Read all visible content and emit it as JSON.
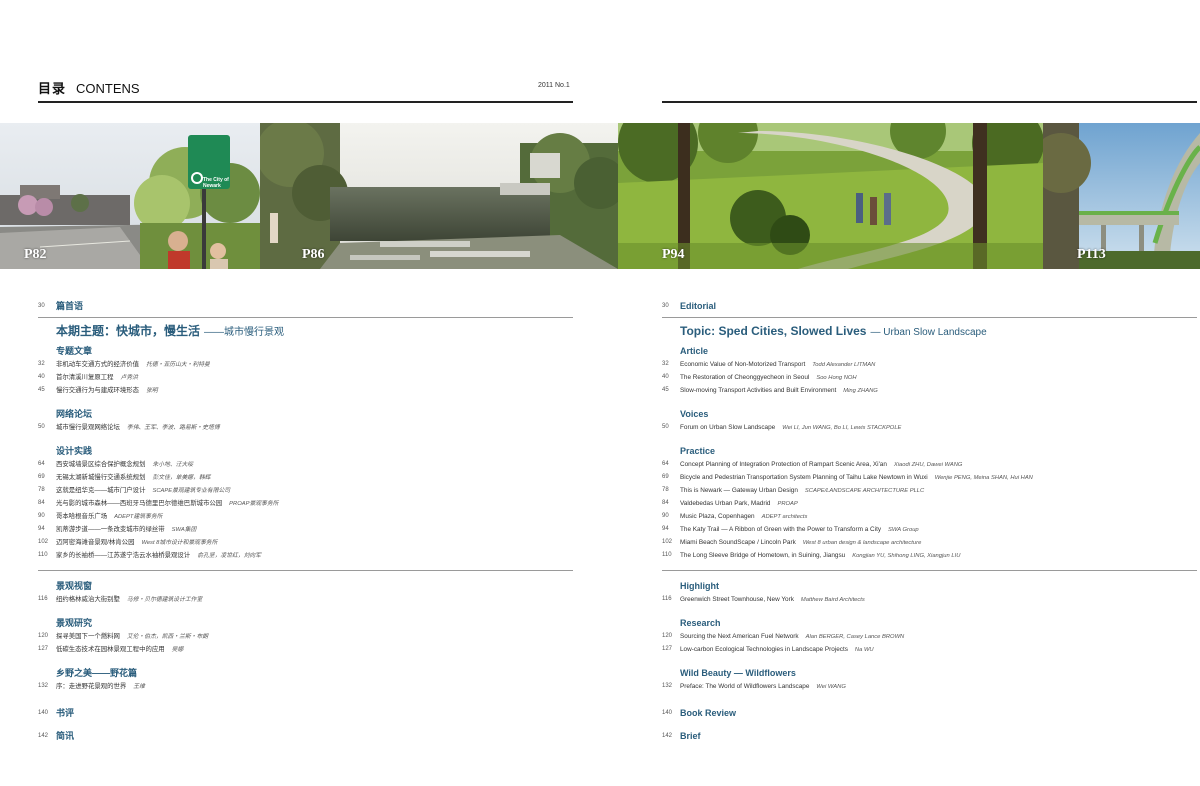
{
  "header": {
    "title_cn": "目录",
    "title_en": "CONTENS",
    "issue": "2011 No.1"
  },
  "photos": [
    {
      "label": "P82"
    },
    {
      "label": "P86"
    },
    {
      "label": "P94"
    },
    {
      "label": "P113"
    }
  ],
  "sign_text": {
    "line1": "The City of",
    "line2": "Newark"
  },
  "left": {
    "editorial": {
      "page": "30",
      "title": "篇首语"
    },
    "topic": {
      "title": "本期主题：快城市，慢生活",
      "sub": "——城市慢行景观"
    },
    "article": {
      "heading": "专题文章",
      "items": [
        {
          "page": "32",
          "title": "非机动车交通方式的经济价值",
          "author": "托德・亚历山大・利特曼"
        },
        {
          "page": "40",
          "title": "首尔清溪川复原工程",
          "author": "卢秀洪"
        },
        {
          "page": "45",
          "title": "慢行交通行为与建成环境形态",
          "author": "张明"
        }
      ]
    },
    "voices": {
      "heading": "网络论坛",
      "items": [
        {
          "page": "50",
          "title": "城市慢行景观网络论坛",
          "author": "李伟、王军、李波、路易斯・史塔博"
        }
      ]
    },
    "practice": {
      "heading": "设计实践",
      "items": [
        {
          "page": "64",
          "title": "西安城墙景区综合保护概念规划",
          "author": "朱小地、汪大绥"
        },
        {
          "page": "69",
          "title": "无锡太湖新城慢行交通系统规划",
          "author": "彭文佳，单美娜，韩辉"
        },
        {
          "page": "78",
          "title": "这就是纽华克——城市门户设计",
          "author": "SCAPE景观建筑专业有限公司"
        },
        {
          "page": "84",
          "title": "光与影的城市森林——西班牙马德里巴尔德维巴斯城市公园",
          "author": "PROAP景观事务所"
        },
        {
          "page": "90",
          "title": "哥本哈根音乐广场",
          "author": "ADEPT建筑事务所"
        },
        {
          "page": "94",
          "title": "凯蒂游步道——一条改变城市的绿丝带",
          "author": "SWA集团"
        },
        {
          "page": "102",
          "title": "迈阿密海滩音景观/林肯公园",
          "author": "West 8城市设计和景观事务所"
        },
        {
          "page": "110",
          "title": "家乡的长袖桥——江苏遂宁浩云水袖桥景观设计",
          "author": "俞孔坚，凌世红，刘向军"
        }
      ]
    },
    "highlight": {
      "heading": "景观视窗",
      "items": [
        {
          "page": "116",
          "title": "纽约格林威治大街别墅",
          "author": "马修・贝尔德建筑设计工作室"
        }
      ]
    },
    "research": {
      "heading": "景观研究",
      "items": [
        {
          "page": "120",
          "title": "探寻美国下一个燃料网",
          "author": "艾伦・伯杰，凯西・兰斯・布朗"
        },
        {
          "page": "127",
          "title": "低碳生态技术在园林景观工程中的应用",
          "author": "吴娜"
        }
      ]
    },
    "wild": {
      "heading": "乡野之美——野花篇",
      "items": [
        {
          "page": "132",
          "title": "序：走进野花景观的世界",
          "author": "王维"
        }
      ]
    },
    "book": {
      "page": "140",
      "title": "书评"
    },
    "brief": {
      "page": "142",
      "title": "简讯"
    }
  },
  "right": {
    "editorial": {
      "page": "30",
      "title": "Editorial"
    },
    "topic": {
      "title": "Topic: Sped Cities, Slowed Lives",
      "sub": "— Urban Slow Landscape"
    },
    "article": {
      "heading": "Article",
      "items": [
        {
          "page": "32",
          "title": "Economic Value of Non-Motorized Transport",
          "author": "Todd Alexander LITMAN"
        },
        {
          "page": "40",
          "title": "The Restoration of Cheonggyecheon in Seoul",
          "author": "Soo Hong NOH"
        },
        {
          "page": "45",
          "title": "Slow-moving Transport Activities and Built Environment",
          "author": "Ming ZHANG"
        }
      ]
    },
    "voices": {
      "heading": "Voices",
      "items": [
        {
          "page": "50",
          "title": "Forum on Urban Slow Landscape",
          "author": "Wei LI, Jun WANG, Bo LI, Lewis STACKPOLE"
        }
      ]
    },
    "practice": {
      "heading": "Practice",
      "items": [
        {
          "page": "64",
          "title": "Concept Planning of Integration Protection of Rampart Scenic Area, Xi'an",
          "author": "Xiaodi ZHU, Dawei WANG"
        },
        {
          "page": "69",
          "title": "Bicycle and Pedestrian Transportation System Planning of Taihu Lake Newtown in Wuxi",
          "author": "Wenjie PENG, Meina SHAN, Hui HAN"
        },
        {
          "page": "78",
          "title": "This is Newark — Gateway Urban Design",
          "author": "SCAPE/LANDSCAPE ARCHITECTURE PLLC"
        },
        {
          "page": "84",
          "title": "Valdebedas Urban Park, Madrid",
          "author": "PROAP"
        },
        {
          "page": "90",
          "title": "Music Plaza, Copenhagen",
          "author": "ADEPT architects"
        },
        {
          "page": "94",
          "title": "The Katy Trail — A Ribbon of Green with the Power to Transform a City",
          "author": "SWA Group"
        },
        {
          "page": "102",
          "title": "Miami Beach SoundScape / Lincoln Park",
          "author": "West 8 urban design & landscape architecture"
        },
        {
          "page": "110",
          "title": "The Long Sleeve Bridge of Hometown, in Suining, Jiangsu",
          "author": "Kongjian YU, Shihong LING, Xiangjun LIU"
        }
      ]
    },
    "highlight": {
      "heading": "Highlight",
      "items": [
        {
          "page": "116",
          "title": "Greenwich Street Townhouse, New York",
          "author": "Matthew Baird Architects"
        }
      ]
    },
    "research": {
      "heading": "Research",
      "items": [
        {
          "page": "120",
          "title": "Sourcing the Next American Fuel Network",
          "author": "Alan BERGER, Casey Lance BROWN"
        },
        {
          "page": "127",
          "title": "Low-carbon Ecological Technologies in Landscape Projects",
          "author": "Na WU"
        }
      ]
    },
    "wild": {
      "heading": "Wild Beauty — Wildflowers",
      "items": [
        {
          "page": "132",
          "title": "Preface: The World of Wildflowers Landscape",
          "author": "Wei WANG"
        }
      ]
    },
    "book": {
      "page": "140",
      "title": "Book Review"
    },
    "brief": {
      "page": "142",
      "title": "Brief"
    }
  },
  "colors": {
    "accent": "#2a5d7c",
    "rule": "#9a9a9a",
    "header_rule": "#222222"
  }
}
